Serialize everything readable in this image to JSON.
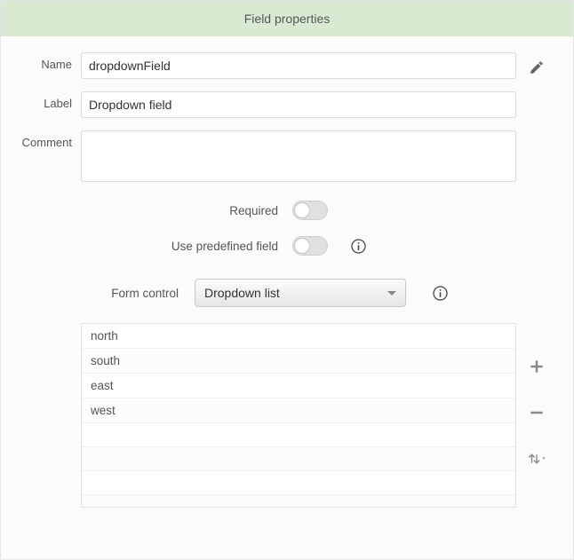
{
  "header": {
    "title": "Field properties"
  },
  "fields": {
    "name": {
      "label": "Name",
      "value": "dropdownField"
    },
    "label_": {
      "label": "Label",
      "value": "Dropdown field"
    },
    "comment": {
      "label": "Comment",
      "value": ""
    }
  },
  "toggles": {
    "required": {
      "label": "Required",
      "on": false
    },
    "predefined": {
      "label": "Use predefined field",
      "on": false
    }
  },
  "formControl": {
    "label": "Form control",
    "value": "Dropdown list"
  },
  "options": [
    "north",
    "south",
    "east",
    "west"
  ]
}
